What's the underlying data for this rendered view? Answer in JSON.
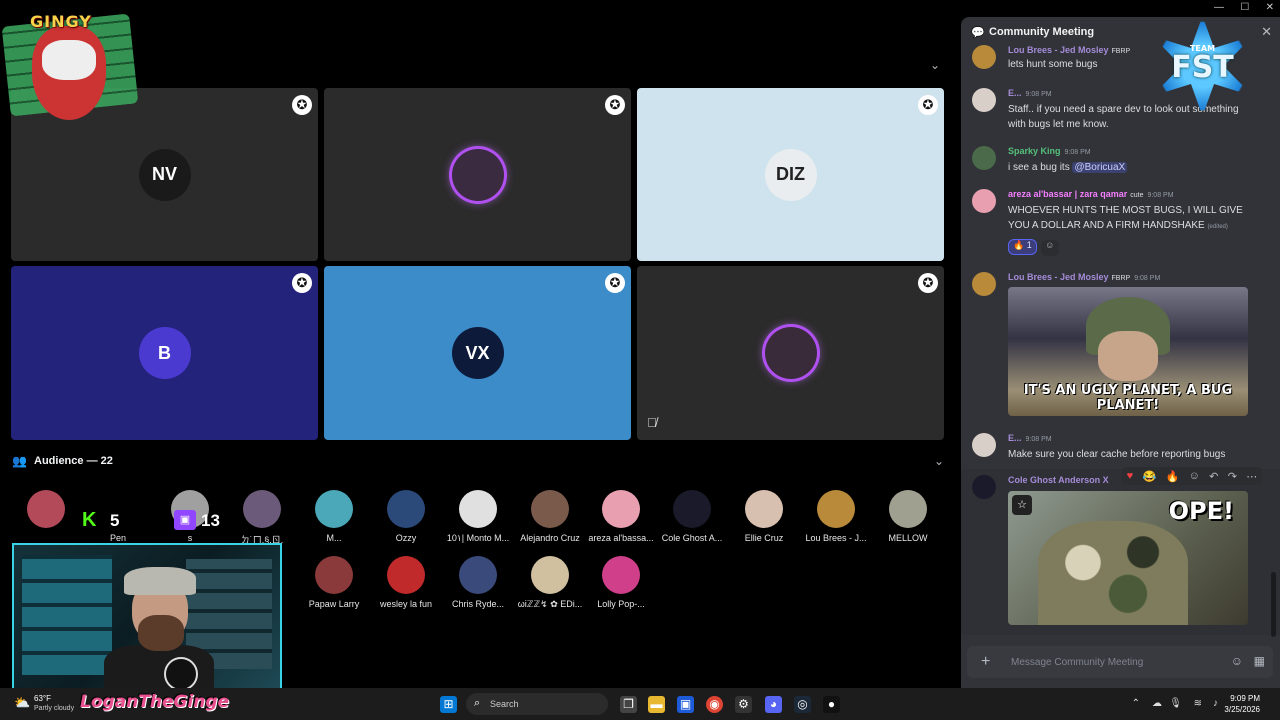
{
  "stage": {
    "tiles": [
      {
        "name": "tile-nv",
        "initials": "NV",
        "bg": "#2b2b2b",
        "avbg": "#1a1a1a",
        "avfg": "#ffffff"
      },
      {
        "name": "tile-girl",
        "initials": "",
        "bg": "#2b2b2b",
        "avbg": "#3a2b40",
        "avfg": "#ffffff"
      },
      {
        "name": "tile-diz",
        "initials": "DIZ",
        "bg": "#cfe3ee",
        "avbg": "#e9edf0",
        "avfg": "#222222"
      },
      {
        "name": "tile-b",
        "initials": "B",
        "bg": "#23237c",
        "avbg": "#4a3ad0",
        "avfg": "#ffffff"
      },
      {
        "name": "tile-vx",
        "initials": "VX",
        "bg": "#3b8cc9",
        "avbg": "#0d1a3a",
        "avfg": "#ffffff"
      },
      {
        "name": "tile-man",
        "initials": "",
        "bg": "#2b2b2b",
        "avbg": "#3a2b3a",
        "avfg": "#ffffff"
      }
    ]
  },
  "audience": {
    "label": "Audience — 22",
    "members": [
      {
        "name": "",
        "color": "#b24a5a"
      },
      {
        "name": "",
        "color": "#222"
      },
      {
        "name": "Pen",
        "color": "#444"
      },
      {
        "name": "s",
        "color": "#a0a0a0"
      },
      {
        "name": "ㄉ˙ㄇ.§.ㄖ.",
        "color": "#6b5a7a"
      },
      {
        "name": "M...",
        "color": "#4aa8b8"
      },
      {
        "name": "Ozzy",
        "color": "#2b4a7a"
      },
      {
        "name": "10١| Monto M...",
        "color": "#e0e0e0"
      },
      {
        "name": "Alejandro Cruz",
        "color": "#7a5a4a"
      },
      {
        "name": "areza al'bassa...",
        "color": "#e8a0b0"
      },
      {
        "name": "Cole Ghost A...",
        "color": "#1a1a2a"
      },
      {
        "name": "Ellie Cruz",
        "color": "#d8c0b0"
      },
      {
        "name": "Lou Brees - J...",
        "color": "#b88a3a"
      },
      {
        "name": "MELLOW",
        "color": "#a0a090"
      },
      {
        "name": "Papaw Larry",
        "color": "#8a3a3a"
      },
      {
        "name": "wesley la fun",
        "color": "#c02a2a"
      },
      {
        "name": "Chris Ryde...",
        "color": "#3a4a7a"
      },
      {
        "name": "ωіℤℤ↯ ✿ ΕDi...",
        "color": "#d0c0a0"
      },
      {
        "name": "Lolly Pop-...",
        "color": "#d0408a"
      }
    ],
    "counts": {
      "kick": "5",
      "twitch": "13"
    }
  },
  "overlays": {
    "gingy_title": "GINGY",
    "streamer_name": "LoganTheGinge",
    "fst_small": "TEAM",
    "fst_label": "FST"
  },
  "chat": {
    "title": "Community Meeting",
    "messages": [
      {
        "author": "Lou Brees - Jed Mosley",
        "author_color": "#a58cd8",
        "tag": "FBRP",
        "time": "",
        "text": "lets hunt some bugs"
      },
      {
        "author": "E...",
        "author_color": "#a58cd8",
        "tag": "",
        "time": "9:08 PM",
        "text": "Staff.. if you need a spare dev to look out something with bugs let me know."
      },
      {
        "author": "Sparky King",
        "author_color": "#55c07a",
        "tag": "",
        "time": "9:08 PM",
        "text_pre": "i see a bug its ",
        "mention": "@BoricuaX"
      },
      {
        "author": "areza al'bassar | zara qamar",
        "author_color": "#f47fff",
        "tag": "cute",
        "time": "9:08 PM",
        "text": "WHOEVER HUNTS THE MOST BUGS, I WILL GIVE YOU A DOLLAR AND A FIRM HANDSHAKE",
        "edited": "(edited)",
        "reaction_count": "1"
      },
      {
        "author": "Lou Brees - Jed Mosley",
        "author_color": "#a58cd8",
        "tag": "FBRP",
        "time": "9:08 PM",
        "gif_caption": "IT'S AN UGLY PLANET, A BUG PLANET!"
      },
      {
        "author": "E...",
        "author_color": "#a58cd8",
        "tag": "",
        "time": "9:08 PM",
        "text": "Make sure you clear cache before reporting bugs"
      },
      {
        "author": "Cole Ghost Anderson X",
        "author_color": "#a58cd8",
        "tag": "",
        "time": "",
        "gif_caption": "OPE!"
      }
    ],
    "composer_placeholder": "Message Community Meeting"
  },
  "taskbar": {
    "weather_temp": "63°F",
    "weather_cond": "Partly cloudy",
    "search_label": "Search",
    "time": "9:09 PM",
    "date": "3/25/2026"
  }
}
